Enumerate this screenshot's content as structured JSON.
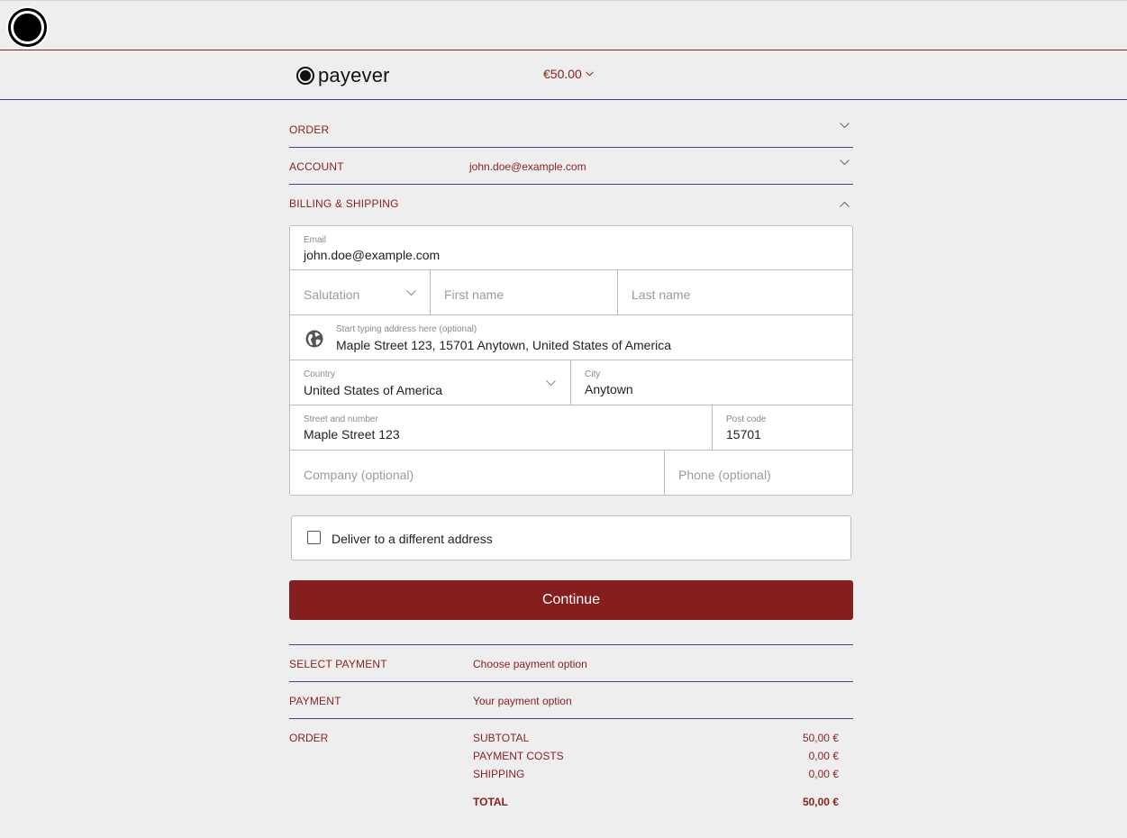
{
  "header": {
    "brand_name": "payever",
    "amount": "€50.00"
  },
  "sections": {
    "order": {
      "label": "ORDER"
    },
    "account": {
      "label": "ACCOUNT",
      "value": "john.doe@example.com"
    },
    "billing": {
      "label": "BILLING & SHIPPING"
    }
  },
  "form": {
    "email": {
      "label": "Email",
      "value": "john.doe@example.com"
    },
    "salutation": {
      "placeholder": "Salutation"
    },
    "first_name": {
      "placeholder": "First name"
    },
    "last_name": {
      "placeholder": "Last name"
    },
    "address_search": {
      "label": "Start typing address here (optional)",
      "value": "Maple Street 123, 15701 Anytown, United States of America"
    },
    "country": {
      "label": "Country",
      "value": "United States of America"
    },
    "city": {
      "label": "City",
      "value": "Anytown"
    },
    "street": {
      "label": "Street and number",
      "value": "Maple Street 123"
    },
    "postcode": {
      "label": "Post code",
      "value": "15701"
    },
    "company": {
      "placeholder": "Company (optional)"
    },
    "phone": {
      "placeholder": "Phone (optional)"
    }
  },
  "deliver_different": {
    "label": "Deliver to a different address",
    "checked": false
  },
  "continue_label": "Continue",
  "select_payment": {
    "label": "SELECT PAYMENT",
    "value": "Choose payment option"
  },
  "payment": {
    "label": "PAYMENT",
    "value": "Your payment option"
  },
  "order_summary": {
    "label": "ORDER",
    "subtotal": {
      "label": "SUBTOTAL",
      "value": "50,00 €"
    },
    "payment_costs": {
      "label": "PAYMENT COSTS",
      "value": "0,00 €"
    },
    "shipping": {
      "label": "SHIPPING",
      "value": "0,00 €"
    },
    "total": {
      "label": "TOTAL",
      "value": "50,00 €"
    }
  },
  "colors": {
    "accent": "#851e1e",
    "separator": "#3b4a7a",
    "background": "#eeeeee"
  }
}
